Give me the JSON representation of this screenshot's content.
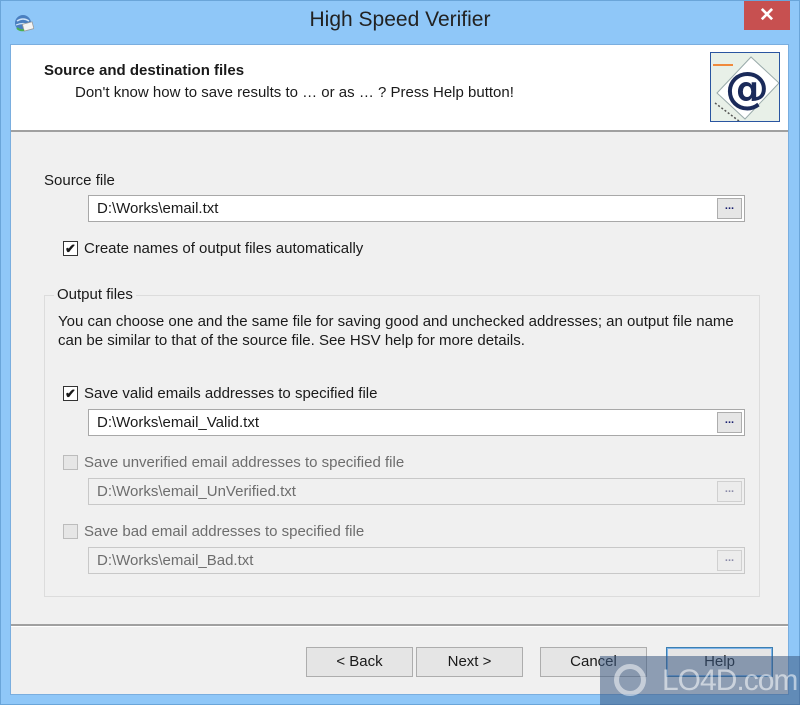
{
  "window": {
    "title": "High Speed Verifier",
    "close_label": "✕"
  },
  "header": {
    "title": "Source and destination files",
    "subtitle": "Don't know how to save results to … or as … ? Press Help button!",
    "logo_glyph": "@"
  },
  "source": {
    "label": "Source file",
    "value": "D:\\Works\\email.txt",
    "browse_label": "..."
  },
  "auto_names": {
    "label": "Create names of output files automatically",
    "checked": true,
    "check_glyph": "✔"
  },
  "output": {
    "legend": "Output files",
    "description": "You can choose one and the same file for saving good and unchecked addresses; an output file name can be similar to that of the source file. See HSV help for more details.",
    "valid": {
      "label": "Save valid emails addresses to specified file",
      "checked": true,
      "enabled": true,
      "value": "D:\\Works\\email_Valid.txt",
      "browse_label": "..."
    },
    "unverified": {
      "label": "Save unverified email addresses to specified file",
      "checked": false,
      "enabled": false,
      "value": "D:\\Works\\email_UnVerified.txt",
      "browse_label": "..."
    },
    "bad": {
      "label": "Save bad email addresses to specified file",
      "checked": false,
      "enabled": false,
      "value": "D:\\Works\\email_Bad.txt",
      "browse_label": "..."
    }
  },
  "buttons": {
    "back": "< Back",
    "next": "Next >",
    "cancel": "Cancel",
    "help": "Help"
  },
  "watermark": {
    "text": "LO4D.com"
  },
  "colors": {
    "frame": "#8fc7f8",
    "close": "#c75050",
    "default_button_border": "#3c7fb1"
  }
}
